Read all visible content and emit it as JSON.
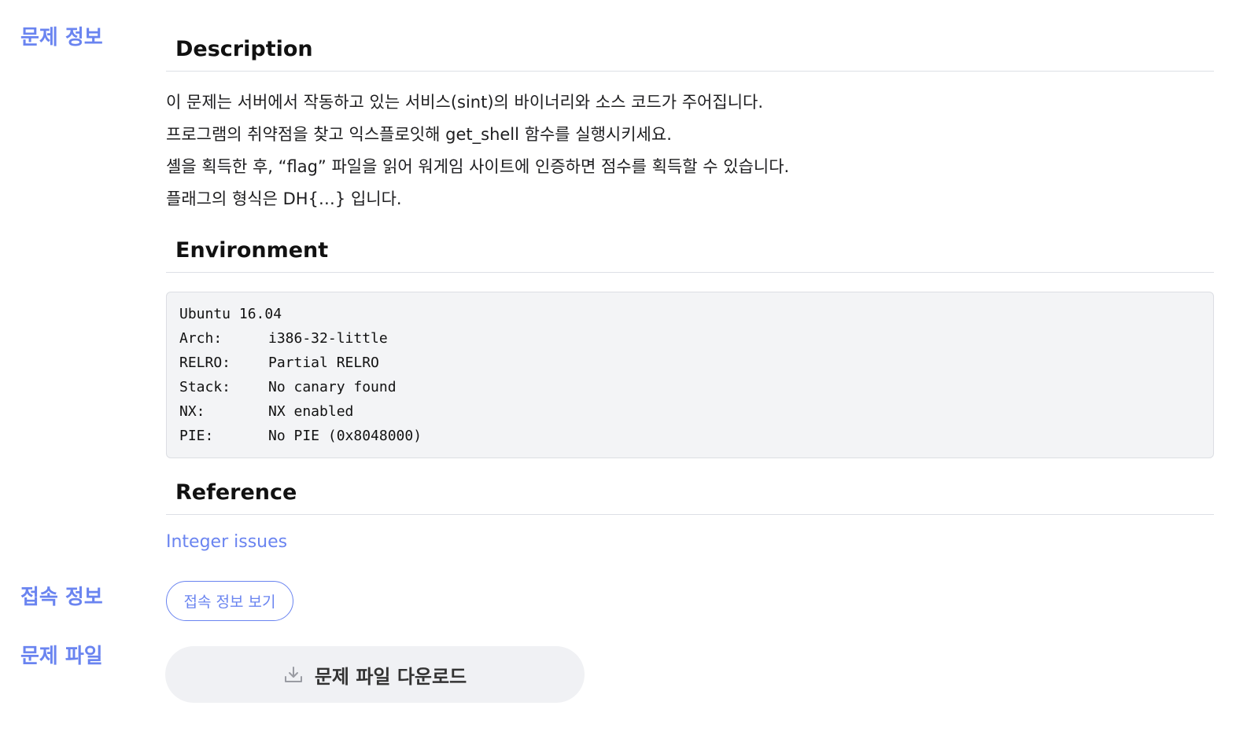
{
  "sidebar": {
    "problem_info": "문제 정보",
    "connection_info": "접속 정보",
    "problem_file": "문제 파일"
  },
  "description": {
    "heading": "Description",
    "lines": [
      "이 문제는 서버에서 작동하고 있는 서비스(sint)의 바이너리와 소스 코드가 주어집니다.",
      "프로그램의 취약점을 찾고 익스플로잇해 get_shell 함수를 실행시키세요.",
      "셸을 획득한 후, “flag” 파일을 읽어 워게임 사이트에 인증하면 점수를 획득할 수 있습니다.",
      "플래그의 형식은 DH{…} 입니다."
    ]
  },
  "environment": {
    "heading": "Environment",
    "title_line": "Ubuntu 16.04",
    "rows": [
      {
        "key": "Arch:",
        "value": "i386-32-little"
      },
      {
        "key": "RELRO:",
        "value": "Partial RELRO"
      },
      {
        "key": "Stack:",
        "value": "No canary found"
      },
      {
        "key": "NX:",
        "value": "NX enabled"
      },
      {
        "key": "PIE:",
        "value": "No PIE (0x8048000)"
      }
    ]
  },
  "reference": {
    "heading": "Reference",
    "link_label": "Integer issues"
  },
  "buttons": {
    "connection_label": "접속 정보 보기",
    "download_label": "문제 파일 다운로드",
    "download_icon": "download-icon"
  },
  "colors": {
    "accent": "#6a84f0",
    "button_bg": "#f0f1f4",
    "code_bg": "#f3f4f6"
  }
}
